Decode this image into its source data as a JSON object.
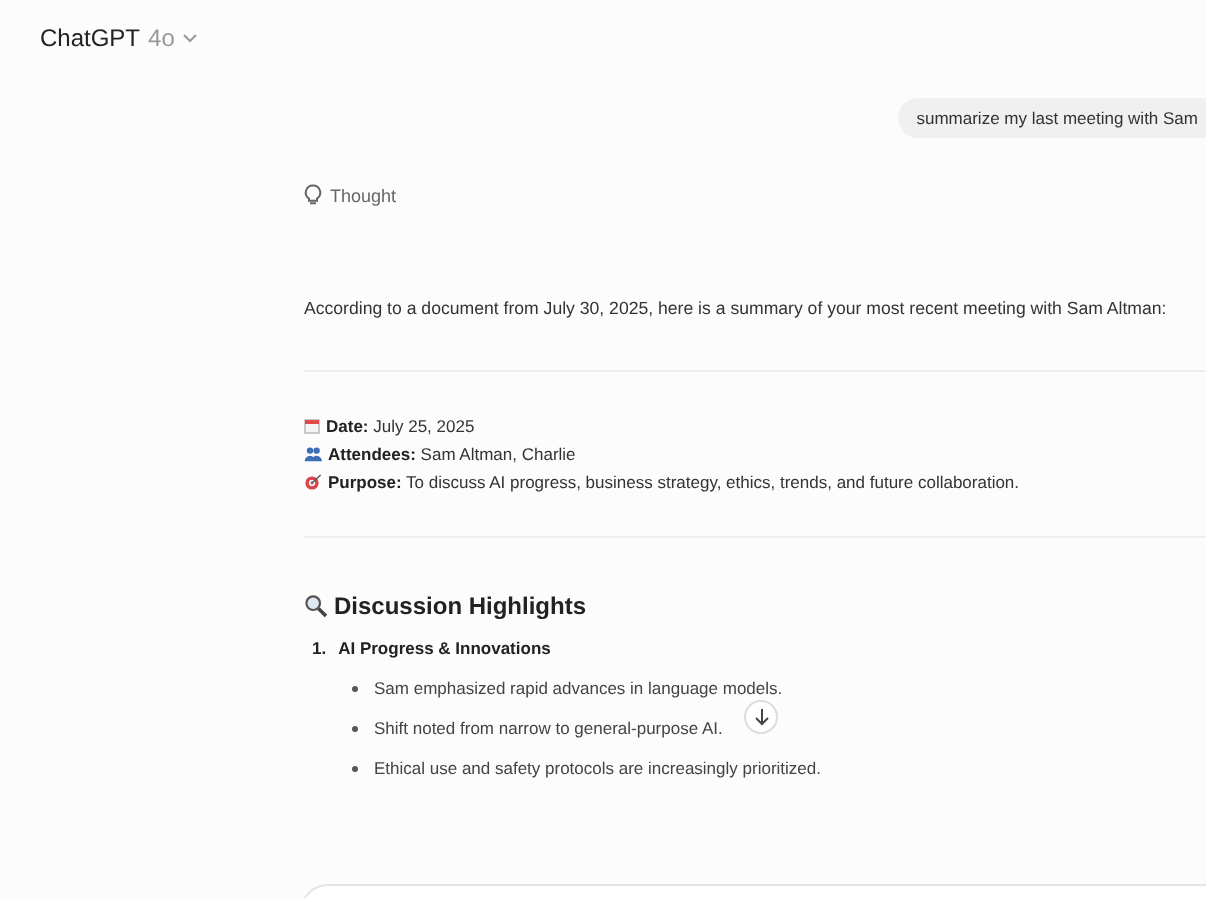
{
  "header": {
    "title": "ChatGPT",
    "model": "4o"
  },
  "user_message": "summarize my last meeting with Sam",
  "thought": "Thought",
  "intro": "According to a document from July 30, 2025, here is a summary of your most recent meeting with Sam Altman:",
  "details": [
    {
      "kind": "calendar",
      "label": "Date:",
      "value": "July 25, 2025"
    },
    {
      "kind": "people",
      "label": "Attendees:",
      "value": "Sam Altman, Charlie"
    },
    {
      "kind": "target",
      "label": "Purpose:",
      "value": "To discuss AI progress, business strategy, ethics, trends, and future collaboration."
    }
  ],
  "section": {
    "heading": "Discussion Highlights",
    "items": [
      {
        "number": "1.",
        "title": "AI Progress & Innovations",
        "bullets": [
          "Sam emphasized rapid advances in language models.",
          "Shift noted from narrow to general-purpose AI.",
          "Ethical use and safety protocols are increasingly prioritized."
        ]
      }
    ]
  }
}
